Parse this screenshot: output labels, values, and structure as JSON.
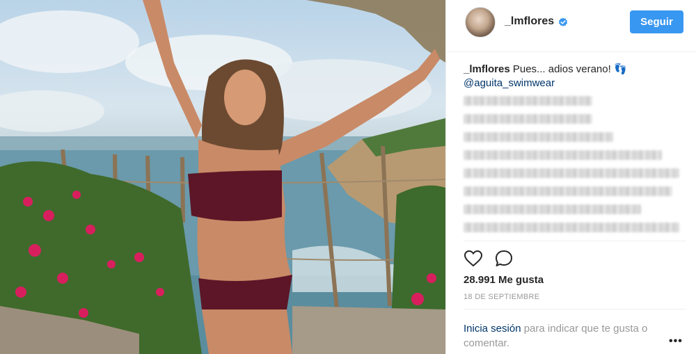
{
  "post": {
    "photo_alt": "photo",
    "header": {
      "username": "_lmflores",
      "follow_label": "Seguir"
    },
    "caption": {
      "username": "_lmflores",
      "text": " Pues... adios verano! ",
      "emoji": "👣",
      "mention": "@aguita_swimwear"
    },
    "blurred_lines": 8,
    "likes": "28.991 Me gusta",
    "date": "18 DE SEPTIEMBRE",
    "login": {
      "link": "Inicia sesión",
      "text": " para indicar que te gusta o comentar."
    },
    "more": "•••"
  },
  "colors": {
    "accent": "#3897f0",
    "link": "#003569",
    "muted": "#999999",
    "text": "#262626"
  }
}
